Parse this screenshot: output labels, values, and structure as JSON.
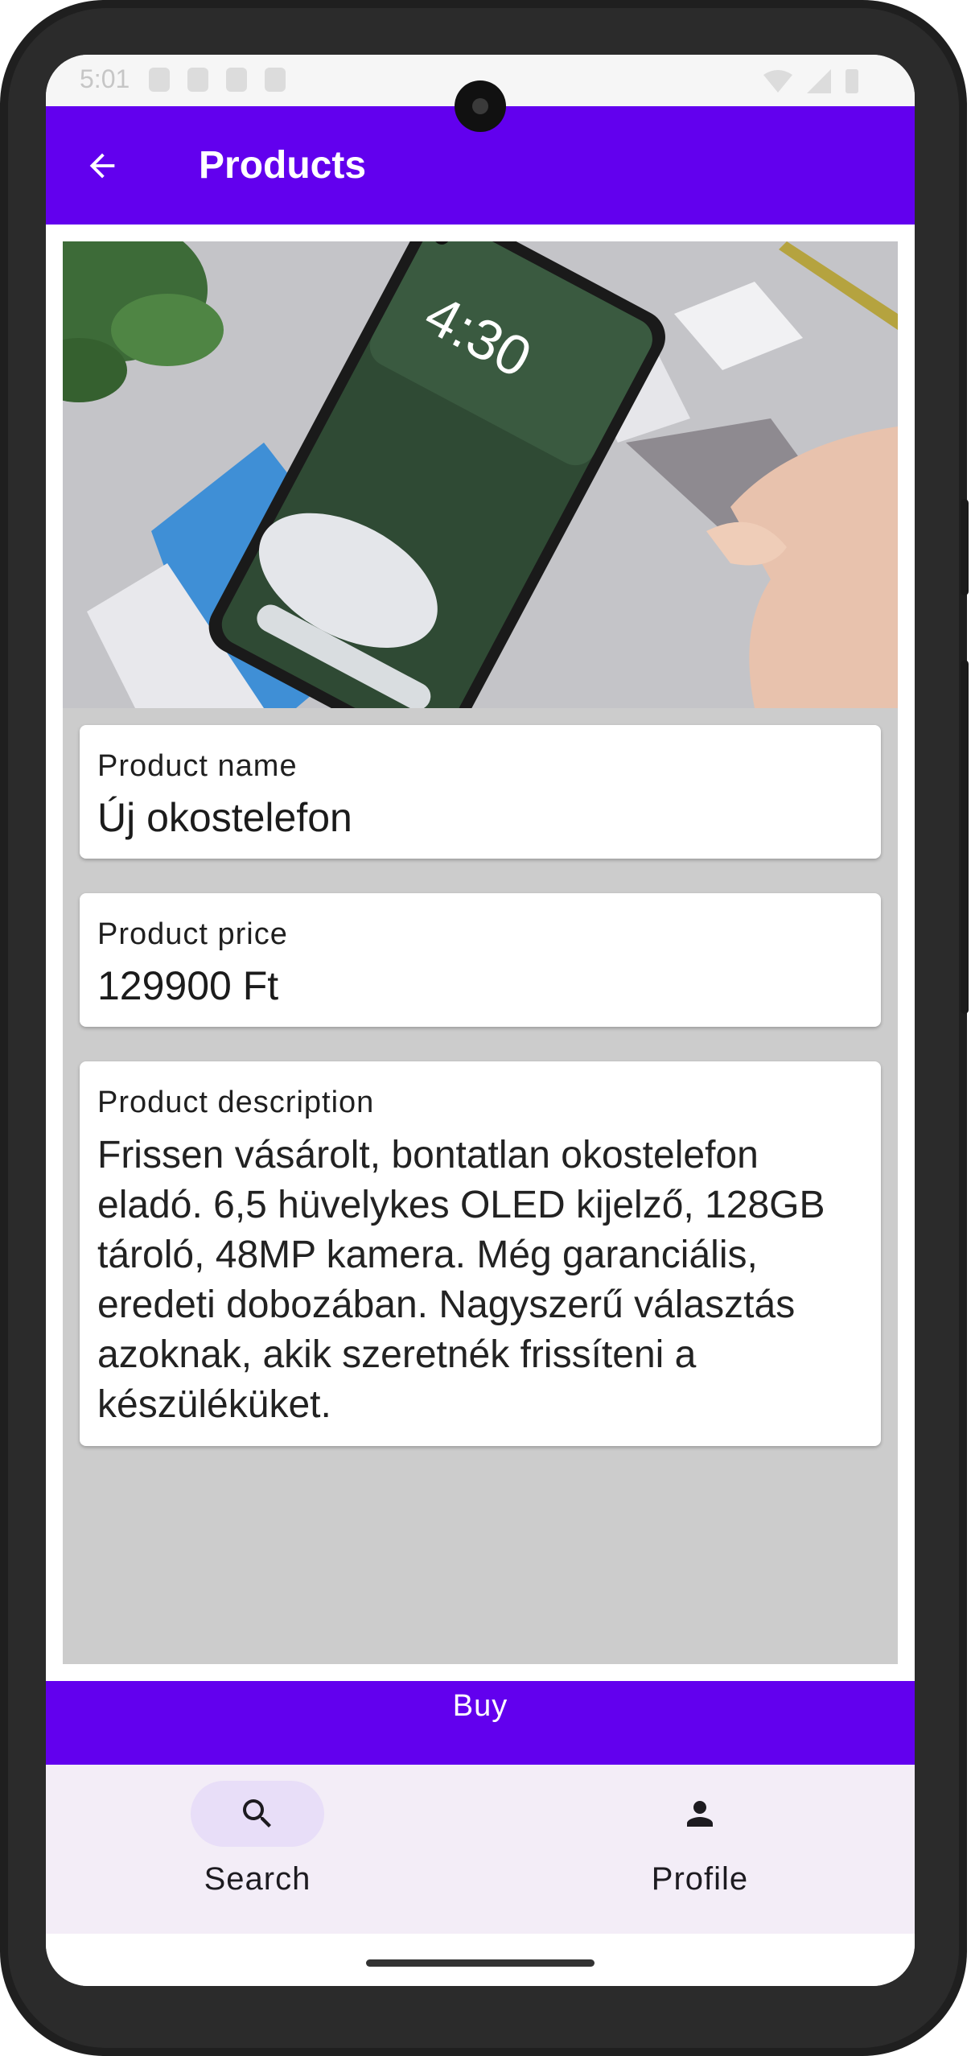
{
  "status_bar": {
    "time": "5:01"
  },
  "app_bar": {
    "title": "Products",
    "back_icon": "arrow-back-icon"
  },
  "product": {
    "image_alt": "smartphone-photo",
    "name_label": "Product name",
    "name_value": "Új okostelefon",
    "price_label": "Product price",
    "price_value": "129900 Ft",
    "description_label": "Product description",
    "description_value": "Frissen vásárolt, bontatlan okostelefon eladó. 6,5 hüvelykes OLED kijelző, 128GB tároló, 48MP kamera. Még garanciális, eredeti dobozában. Nagyszerű választás azoknak, akik szeretnék frissíteni a készüléküket."
  },
  "buy_button": {
    "label": "Buy"
  },
  "bottom_nav": {
    "items": [
      {
        "label": "Search",
        "icon": "search-icon",
        "active": true
      },
      {
        "label": "Profile",
        "icon": "person-icon",
        "active": false
      }
    ]
  },
  "colors": {
    "primary": "#6200ee",
    "nav_background": "#f3edf7",
    "nav_active_pill": "#e8def8",
    "content_background": "#cccccc"
  }
}
